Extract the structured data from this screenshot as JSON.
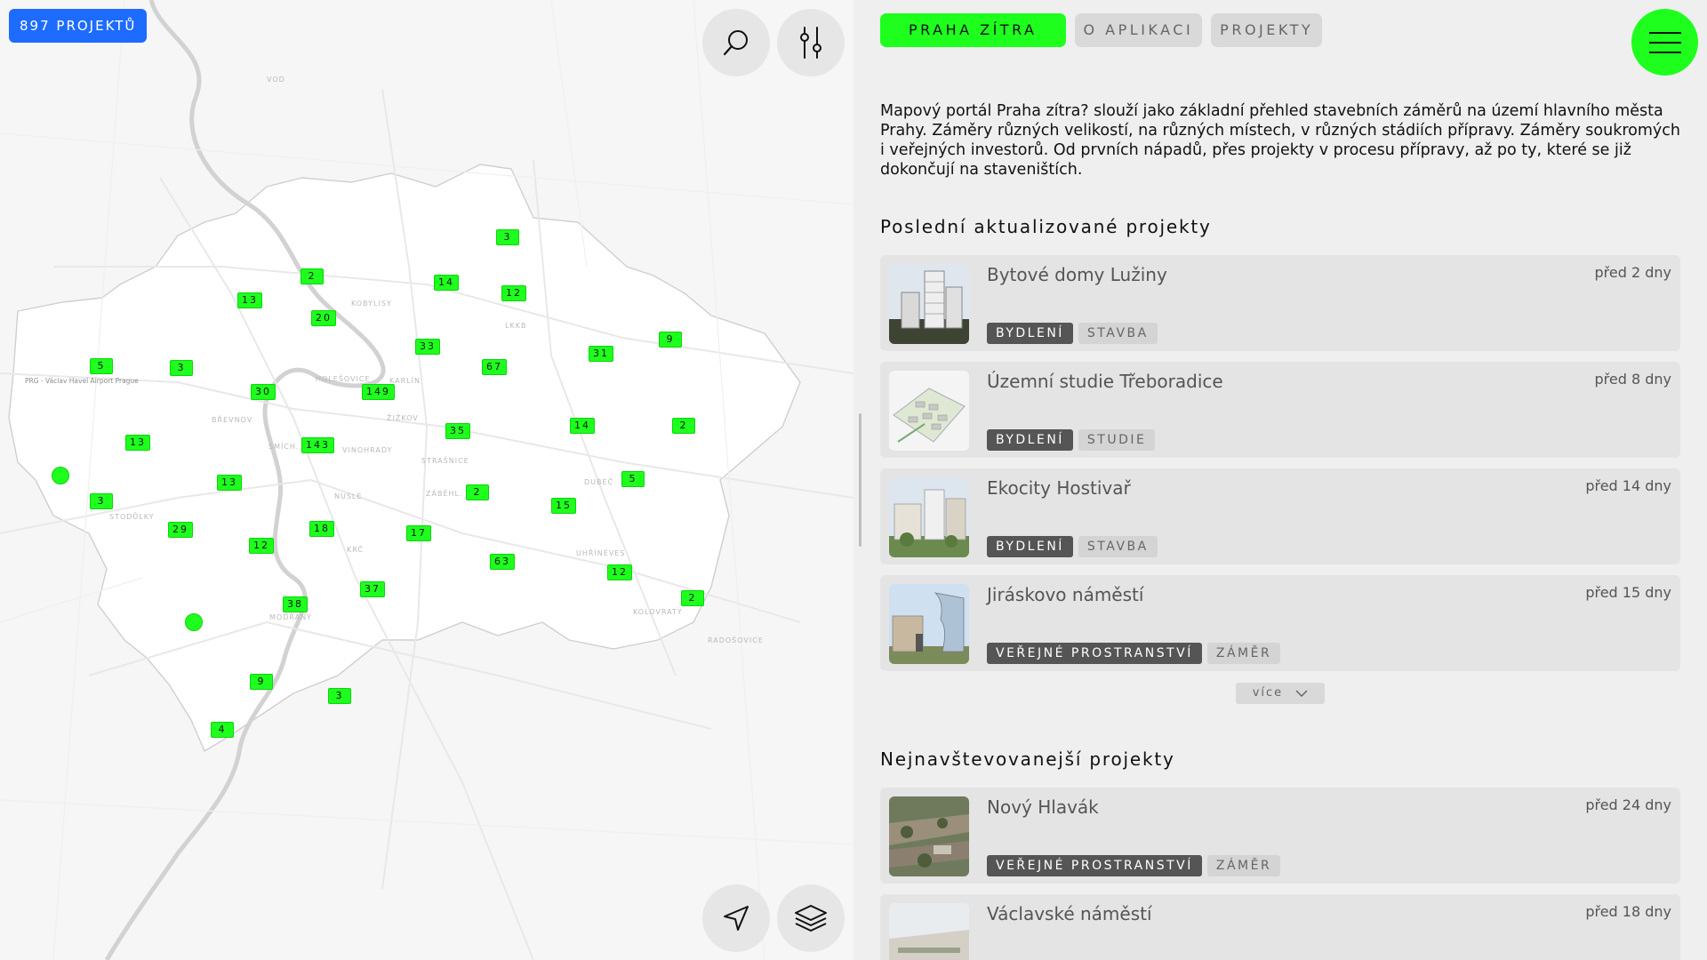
{
  "map": {
    "project_count_label": "897 PROJEKTŮ",
    "labels": [
      "VOD",
      "KOBYLISY",
      "LKKB",
      "HOLEŠOVICE",
      "KARLÍN",
      "ŽIŽKOV",
      "BŘEVNOV",
      "VINOHRADY",
      "SMÍCH.",
      "STRAŠNICE",
      "NUSLE",
      "ZÁBĚHL.",
      "DUBEČ",
      "STODŮLKY",
      "KRČ",
      "UHŘÍNĚVES",
      "KOLOVRATY",
      "MODŘANY",
      "RADOŠOVICE"
    ],
    "airport_label": "PRG - Václav Havel Airport Prague",
    "clusters": [
      "3",
      "2",
      "14",
      "12",
      "13",
      "20",
      "33",
      "5",
      "3",
      "30",
      "149",
      "67",
      "31",
      "9",
      "143",
      "35",
      "14",
      "2",
      "13",
      "13",
      "2",
      "5",
      "3",
      "15",
      "29",
      "18",
      "12",
      "17",
      "63",
      "12",
      "37",
      "38",
      "2",
      "9",
      "3",
      "4"
    ]
  },
  "nav": {
    "items": [
      "PRAHA ZÍTRA",
      "O APLIKACI",
      "PROJEKTY"
    ]
  },
  "intro": "Mapový portál Praha zítra? slouží jako základní přehled stavebních záměrů na území hlavního města Prahy. Záměry různých velikostí, na různých místech, v různých stádiích přípravy. Záměry soukromých i veřejných investorů. Od prvních nápadů, přes projekty v procesu přípravy, až po ty, které se již dokončují na staveništích.",
  "recent": {
    "title": "Poslední aktualizované projekty",
    "items": [
      {
        "title": "Bytové domy Lužiny",
        "date": "před 2 dny",
        "tags": [
          "BYDLENÍ",
          "STAVBA"
        ]
      },
      {
        "title": "Územní studie Třeboradice",
        "date": "před 8 dny",
        "tags": [
          "BYDLENÍ",
          "STUDIE"
        ]
      },
      {
        "title": "Ekocity Hostivař",
        "date": "před 14 dny",
        "tags": [
          "BYDLENÍ",
          "STAVBA"
        ]
      },
      {
        "title": "Jiráskovo náměstí",
        "date": "před 15 dny",
        "tags": [
          "VEŘEJNÉ PROSTRANSTVÍ",
          "ZÁMĚR"
        ]
      }
    ],
    "more_label": "více"
  },
  "popular": {
    "title": "Nejnavštevovanejší projekty",
    "items": [
      {
        "title": "Nový Hlavák",
        "date": "před 24 dny",
        "tags": [
          "VEŘEJNÉ PROSTRANSTVÍ",
          "ZÁMĚR"
        ]
      },
      {
        "title": "Václavské náměstí",
        "date": "před 18 dny",
        "tags": []
      }
    ]
  },
  "colors": {
    "accent": "#1eff1e",
    "badge": "#1e6cff",
    "panel": "#efefef"
  },
  "icons": [
    "search-icon",
    "filter-sliders-icon",
    "menu-icon",
    "locate-arrow-icon",
    "layers-icon",
    "chevron-down-icon"
  ]
}
